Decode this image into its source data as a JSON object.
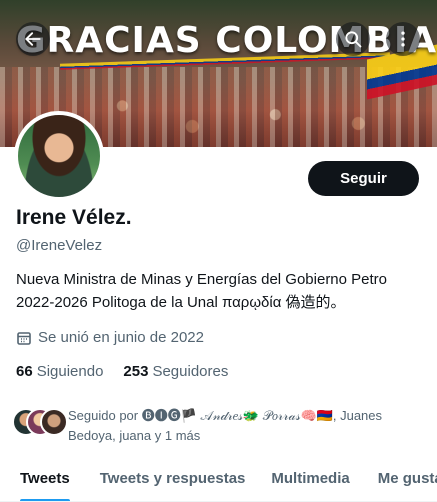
{
  "banner": {
    "title": "GRACIAS COLOMBIA"
  },
  "header": {
    "back_icon": "arrow-left-icon",
    "search_icon": "search-icon",
    "more_icon": "more-vertical-icon"
  },
  "profile": {
    "follow_label": "Seguir",
    "name": "Irene Vélez.",
    "handle": "@IreneVelez",
    "bio_line1": "Nueva Ministra de Minas y Energías del Gobierno Petro",
    "bio_line2": "2022-2026 Politoga de la Unal παρῳδία 偽造的。",
    "joined": "Se unió en junio de 2022",
    "following_count": "66",
    "following_label": "Siguiendo",
    "followers_count": "253",
    "followers_label": "Seguidores",
    "followed_by": "Seguido por 🅑🅘🅖🏴 𝒜𝓃𝒹𝓇𝑒𝓈🐲 𝒫𝑜𝓇𝓇𝒶𝓈🧠🇦🇲, Juanes Bedoya, juana y 1 más"
  },
  "tabs": [
    {
      "label": "Tweets",
      "active": true
    },
    {
      "label": "Tweets y respuestas",
      "active": false
    },
    {
      "label": "Multimedia",
      "active": false
    },
    {
      "label": "Me gusta",
      "active": false
    }
  ],
  "colors": {
    "accent": "#1d9bf0",
    "text_primary": "#0f1419",
    "text_secondary": "#536471"
  }
}
